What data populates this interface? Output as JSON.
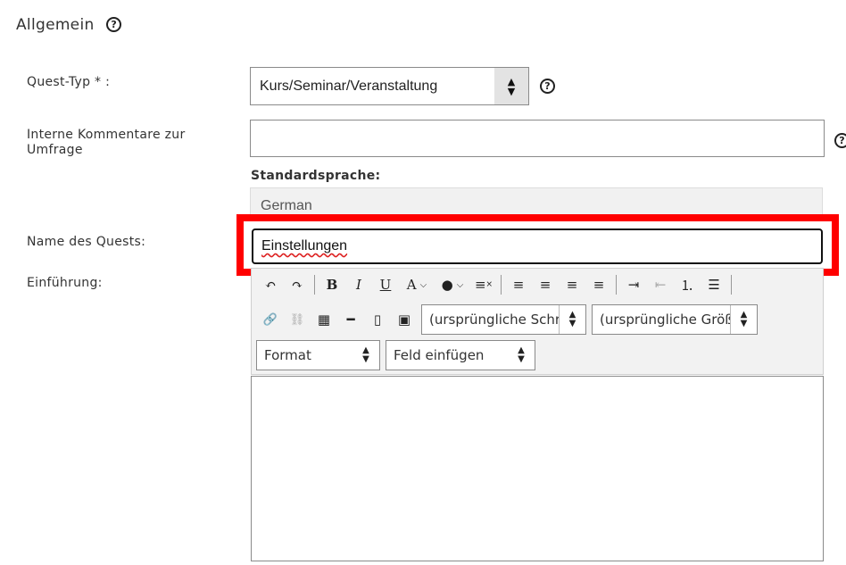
{
  "section": {
    "title": "Allgemein",
    "help": "?"
  },
  "quest_type": {
    "label": "Quest-Typ * :",
    "value": "Kurs/Seminar/Veranstaltung",
    "help": "?"
  },
  "internal_comments": {
    "label_line1": "Interne Kommentare zur",
    "label_line2": "Umfrage",
    "value": "",
    "help": "?"
  },
  "default_language": {
    "label": "Standardsprache:",
    "value": "German"
  },
  "quest_name": {
    "label": "Name des Quests:",
    "value": "Einstellungen"
  },
  "introduction": {
    "label": "Einführung:",
    "font_select": "(ursprüngliche Schriftart)",
    "size_select": "(ursprüngliche Größe)",
    "format_select": "Format",
    "insert_field_select": "Feld einfügen",
    "content": ""
  },
  "toolbar_glyphs": {
    "undo": "↶",
    "redo": "↷",
    "bold": "B",
    "italic": "I",
    "underline": "U",
    "font_color": "A",
    "bg_color": "●",
    "remove_format": "≡",
    "align_left": "≡",
    "align_center": "≡",
    "align_right": "≡",
    "justify": "≡",
    "indent": "⇥",
    "outdent": "⇤",
    "ordered_list": "⒈",
    "bullet_list": "☰",
    "link": "🔗",
    "unlink": "⛓",
    "table": "▦",
    "hr": "━",
    "source": "▯",
    "image": "▣"
  },
  "colors": {
    "highlight": "#ff0000",
    "toolbar_bg": "#f2f2f2",
    "spell_error": "#dd2222"
  }
}
